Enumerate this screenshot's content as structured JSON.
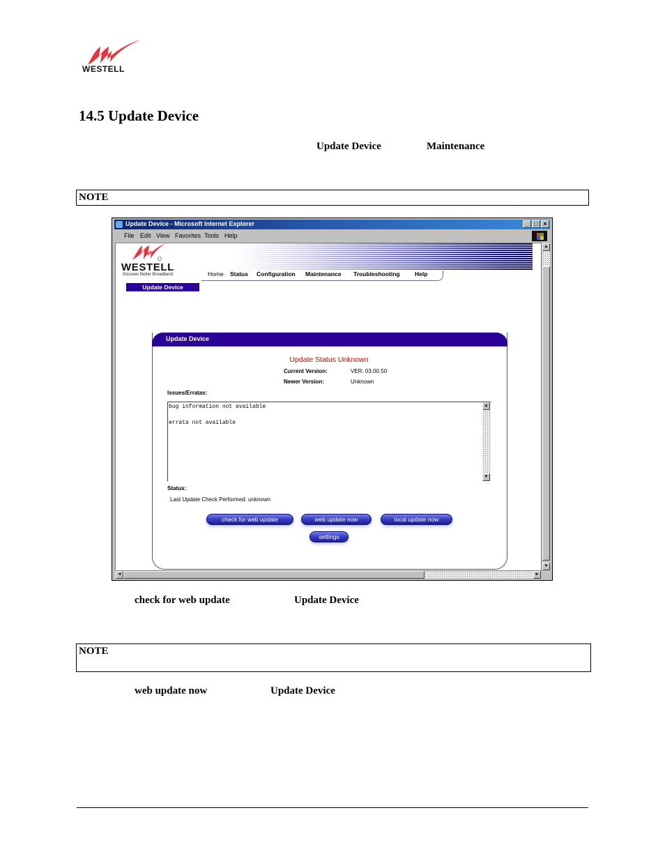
{
  "document": {
    "logo_text": "WESTELL",
    "section_title": "14.5 Update Device",
    "intro_terms": [
      "Update Device",
      "Maintenance"
    ],
    "note1_label": "NOTE",
    "para2_terms": [
      "check for web update",
      "Update Device"
    ],
    "note2_label": "NOTE",
    "para3_terms": [
      "web update now",
      "Update Device"
    ]
  },
  "browser": {
    "title": "Update Device - Microsoft Internet Explorer",
    "menu": [
      "File",
      "Edit",
      "View",
      "Favorites",
      "Tools",
      "Help"
    ],
    "window_buttons": {
      "minimize": "_",
      "maximize": "□",
      "close": "×"
    }
  },
  "westell_page": {
    "logo_text": "WESTELL",
    "tagline": "Discover  Better  Broadband",
    "sidebar_active": "Update Device",
    "nav": [
      "Home",
      "Status",
      "Configuration",
      "Maintenance",
      "Troubleshooting",
      "Help"
    ],
    "panel": {
      "title": "Update Device",
      "status_headline": "Update Status Unknown",
      "current_version_label": "Current Version:",
      "current_version_value": "VER: 03.00.50",
      "newer_version_label": "Newer Version:",
      "newer_version_value": "Unknown",
      "issues_label": "Issues/Erratas:",
      "issues_text": "bug information not available\n\nerrata not available",
      "status_label": "Status:",
      "status_text": "Last Update Check Performed: unknown",
      "buttons": {
        "check": "check for web update",
        "web_update": "web update now",
        "local_update": "local update now",
        "settings": "settings"
      }
    }
  },
  "colors": {
    "westell_red": "#e8323c",
    "panel_header": "#2a0096",
    "status_red": "#e00000",
    "titlebar_start": "#0a246a",
    "titlebar_end": "#3a8ad8"
  }
}
